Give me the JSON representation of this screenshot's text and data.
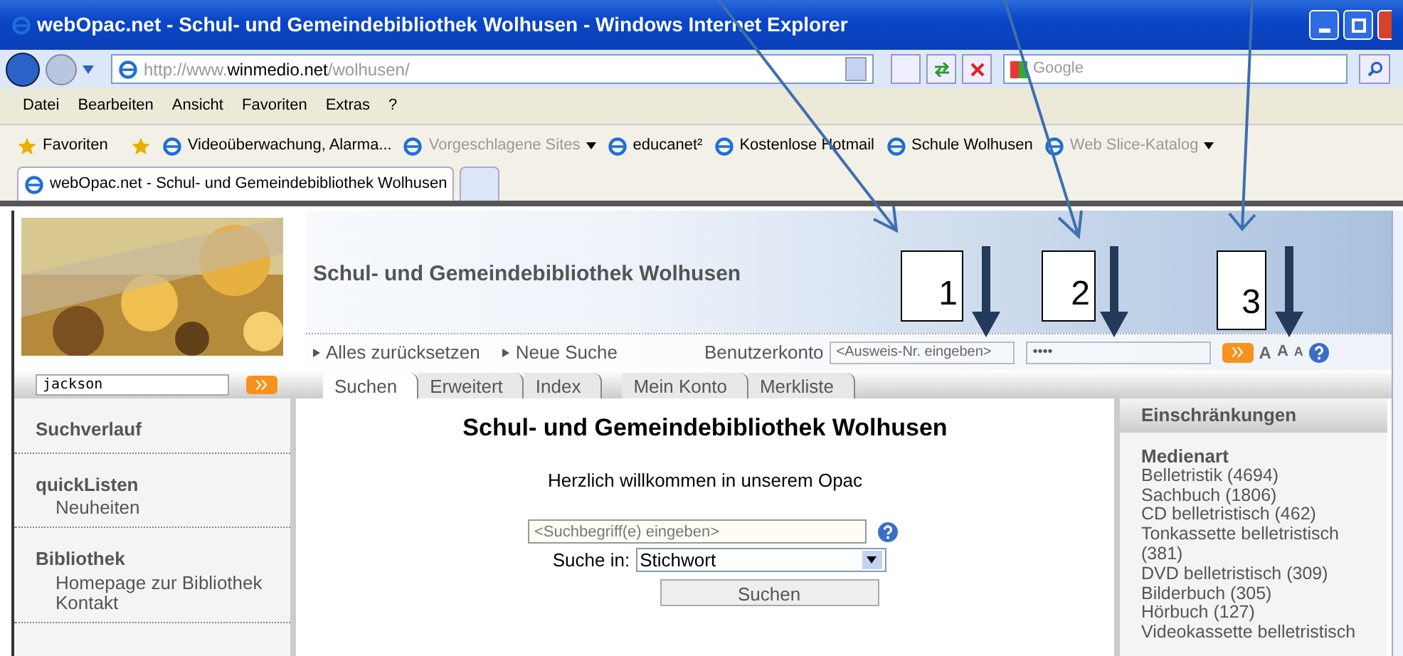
{
  "window": {
    "title": "webOpac.net - Schul- und Gemeindebibliothek Wolhusen - Windows Internet Explorer"
  },
  "address_bar": {
    "url_prefix": "http://www.",
    "url_domain": "winmedio.net",
    "url_path": "/wolhusen/",
    "search_placeholder": "Google"
  },
  "menu": [
    "Datei",
    "Bearbeiten",
    "Ansicht",
    "Favoriten",
    "Extras",
    "?"
  ],
  "favorites_bar": {
    "label": "Favoriten",
    "items": [
      {
        "label": "Videoüberwachung, Alarma...",
        "disabled": false,
        "dropdown": false
      },
      {
        "label": "Vorgeschlagene Sites",
        "disabled": true,
        "dropdown": true
      },
      {
        "label": "educanet²",
        "disabled": false,
        "dropdown": false
      },
      {
        "label": "Kostenlose Hotmail",
        "disabled": false,
        "dropdown": false
      },
      {
        "label": "Schule Wolhusen",
        "disabled": false,
        "dropdown": false
      },
      {
        "label": "Web Slice-Katalog",
        "disabled": true,
        "dropdown": true
      }
    ]
  },
  "browser_tabs": [
    {
      "label": "webOpac.net - Schul- und Gemeindebibliothek Wolhusen",
      "selected": true
    }
  ],
  "page": {
    "header_title": "Schul- und Gemeindebibliothek Wolhusen",
    "links": [
      "Alles zurücksetzen",
      "Neue Suche"
    ],
    "account": {
      "label": "Benutzerkonto",
      "id_placeholder": "<Ausweis-Nr. eingeben>",
      "password_value": "••••",
      "font_sizes": [
        "A",
        "A",
        "A"
      ]
    },
    "quick_search": {
      "value": "jackson"
    },
    "tabs": [
      {
        "label": "Suchen",
        "selected": true
      },
      {
        "label": "Erweitert",
        "selected": false
      },
      {
        "label": "Index",
        "selected": false
      },
      {
        "label": "Mein Konto",
        "selected": false
      },
      {
        "label": "Merkliste",
        "selected": false
      }
    ],
    "sidebar": [
      {
        "title": "Suchverlauf"
      },
      {
        "title": "quickListen",
        "items": [
          "Neuheiten"
        ]
      },
      {
        "title": "Bibliothek",
        "items": [
          "Homepage zur Bibliothek",
          "Kontakt"
        ]
      }
    ],
    "main": {
      "title": "Schul- und Gemeindebibliothek Wolhusen",
      "welcome": "Herzlich willkommen in unserem Opac",
      "search_placeholder": "<Suchbegriff(e) eingeben>",
      "search_in_label": "Suche in:",
      "search_in_value": "Stichwort",
      "search_button": "Suchen"
    },
    "filters": {
      "title": "Einschränkungen",
      "group": "Medienart",
      "items": [
        "Belletristik (4694)",
        "Sachbuch (1806)",
        "CD belletristisch (462)",
        "Tonkassette belletristisch (381)",
        "DVD belletristisch (309)",
        "Bilderbuch (305)",
        "Hörbuch (127)",
        "Videokassette belletristisch"
      ]
    }
  },
  "callouts": [
    "1",
    "2",
    "3"
  ]
}
